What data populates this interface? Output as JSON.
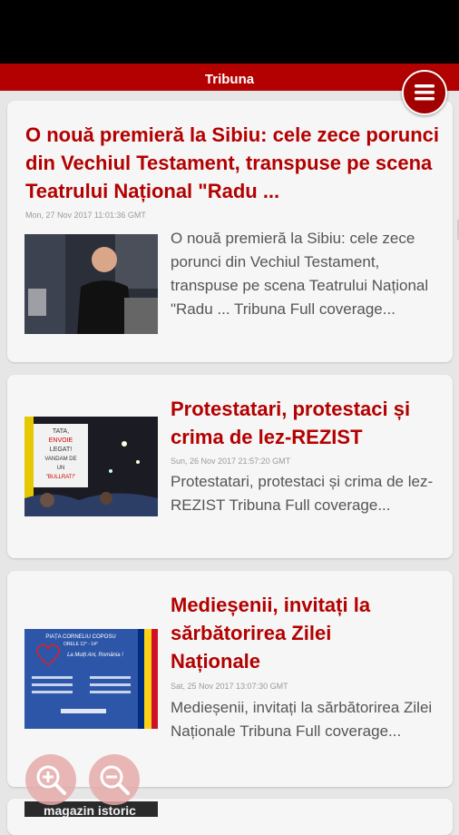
{
  "app": {
    "title": "Tribuna"
  },
  "articles": [
    {
      "title": "O nouă premieră la Sibiu: cele zece porunci din Vechiul Testament, transpuse pe scena Teatrului Național \"Radu ...",
      "date": "Mon, 27 Nov 2017 11:01:36 GMT",
      "body": "O nouă premieră la Sibiu: cele zece porunci din Vechiul Testament, transpuse pe scena Teatrului Național \"Radu ... Tribuna  Full coverage..."
    },
    {
      "title": "Protestatari, protestaci și crima de lez-REZIST",
      "date": "Sun, 26 Nov 2017 21:57:20 GMT",
      "body": "Protestatari, protestaci și crima de lez-REZIST  Tribuna  Full coverage...",
      "image_text": [
        "TATA,",
        "ENVOIE",
        "LEGAT!",
        "VANDAM DE",
        "UN",
        "\"BULLRAT!\""
      ]
    },
    {
      "title": "Medieșenii, invitați la sărbătorirea Zilei Naționale",
      "date": "Sat, 25 Nov 2017 13:07:30 GMT",
      "body": "Medieșenii, invitați la sărbătorirea Zilei Naționale  Tribuna  Full coverage...",
      "image_text": [
        "PIAȚA CORNELIU COPOSU",
        "ORELE 12° - 14°",
        "La Mulți Ani, România !"
      ]
    }
  ],
  "partial_card_image_text": "magazin istoric",
  "colors": {
    "brand": "#b30000",
    "background": "#e6e6e6",
    "card": "#f6f6f6"
  },
  "icons": [
    "menu-icon",
    "zoom-in-icon",
    "zoom-out-icon"
  ]
}
